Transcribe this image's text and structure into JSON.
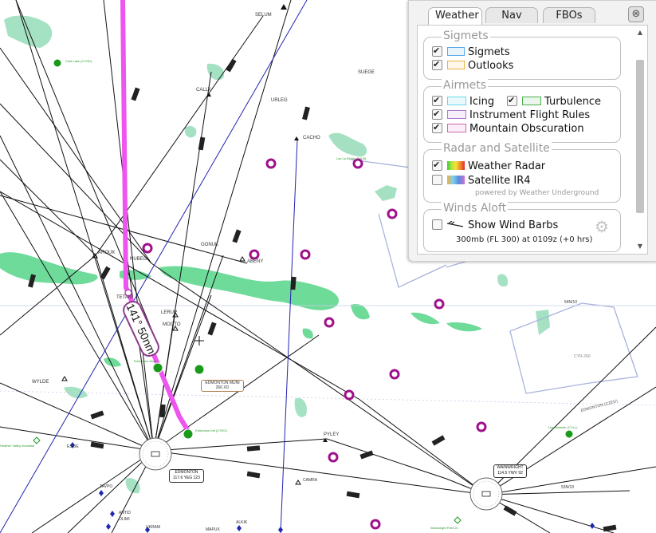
{
  "map": {
    "fix_labels": [
      "SELUM",
      "SUEGE",
      "CALLY",
      "URLEG",
      "CACHO",
      "Lac La Biche (CYLB)",
      "Cold Lake (CYOD)",
      "AROUK",
      "NUBEG",
      "GONUK",
      "ABENY",
      "TETAN",
      "LERUP",
      "MOOTO",
      "WYLDE",
      "PYLEY",
      "Edmonton Muni",
      "EDMONTON MUNI",
      "266 XD",
      "Edmonton Intl (CYEG)",
      "ESKIE",
      "TAVPO",
      "ANTID",
      "OLIMI",
      "UKRAM",
      "MAPUX",
      "ALKIK",
      "CAMRA",
      "EDMONTON",
      "117.6 YEG 123",
      "WAINWRIGHT",
      "114.5 YWV 92",
      "Lloydminster (CYLL)",
      "Wainwright Field 21",
      "EDMONTON (CZEG)",
      "CYR-260",
      "54N/10",
      "53N/10",
      "J515",
      "J516",
      "J517",
      "J518",
      "Heather Valley Industrial"
    ],
    "route_label": "141° 50nm",
    "edmonton_id": "YEG",
    "wainwright_id": "YWV"
  },
  "panel": {
    "tabs": [
      "Weather",
      "Nav",
      "FBOs"
    ],
    "active_tab": "Weather",
    "close": "⊗",
    "sigmets": {
      "title": "Sigmets",
      "items": [
        {
          "label": "Sigmets",
          "checked": true,
          "color": "#5aa9e6"
        },
        {
          "label": "Outlooks",
          "checked": true,
          "color": "#f0b040"
        }
      ]
    },
    "airmets": {
      "title": "Airmets",
      "icing": {
        "label": "Icing",
        "checked": true,
        "color": "#6ad6e8"
      },
      "turbulence": {
        "label": "Turbulence",
        "checked": true,
        "color": "#4cae4c"
      },
      "ifr": {
        "label": "Instrument Flight Rules",
        "checked": true,
        "color": "#b07ac8"
      },
      "mountain": {
        "label": "Mountain Obscuration",
        "checked": true,
        "color": "#c86ab0"
      }
    },
    "radar": {
      "title": "Radar and Satellite",
      "weather_radar": {
        "label": "Weather Radar",
        "checked": true
      },
      "satellite": {
        "label": "Satellite IR4",
        "checked": false
      },
      "powered": "powered by Weather Underground"
    },
    "winds": {
      "title": "Winds Aloft",
      "show_barbs": {
        "label": "Show Wind Barbs",
        "checked": false
      },
      "level": "300mb (FL 300) at 0109z (+0 hrs)"
    }
  },
  "colors": {
    "route": "#ee55ee",
    "airport": "#1a9a1a",
    "waypoint": "#a0108a",
    "airway": "#111111",
    "blue_route": "#2323b0",
    "weather": "#3fcf78",
    "boundary": "#a9b3dc"
  }
}
